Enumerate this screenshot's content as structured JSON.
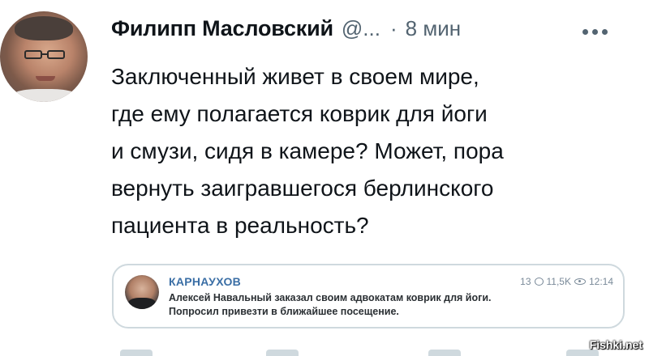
{
  "tweet": {
    "author_name": "Филипп Масловский",
    "handle": "@...",
    "separator": "·",
    "time": "8 мин",
    "text": "Заключенный живет в своем мире,\nгде ему полагается коврик для йоги\nи смузи, сидя в камере? Может, пора\nвернуть заигравшегося берлинского\nпациента в реальность?"
  },
  "more_icon": "more-horizontal-icon",
  "quote": {
    "channel": "КАРНАУХОВ",
    "comments": "13",
    "views": "11,5K",
    "time": "12:14",
    "text": "Алексей Навальный заказал своим адвокатам коврик для йоги.\nПопросил привезти в ближайшее посещение."
  },
  "watermark": "Fishki.net"
}
